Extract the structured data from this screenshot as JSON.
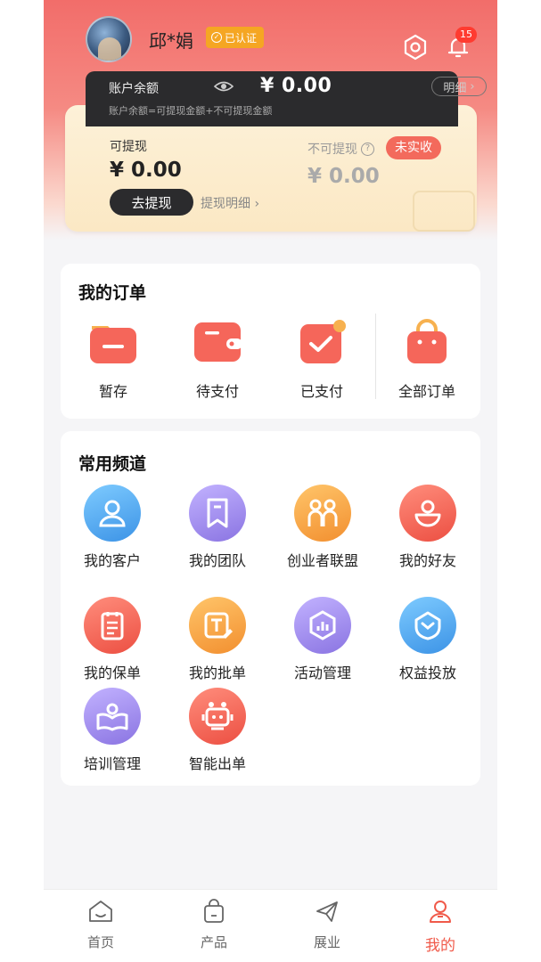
{
  "header": {
    "username": "邱*娟",
    "verified_label": "已认证",
    "notification_count": "15"
  },
  "balance": {
    "label": "账户余额",
    "value": "¥ 0.00",
    "detail_label": "明细",
    "note": "账户余额=可提现金额+不可提现金额"
  },
  "withdraw": {
    "available_label": "可提现",
    "available_value": "¥ 0.00",
    "withdraw_button": "去提现",
    "withdraw_detail_link": "提现明细 ›",
    "unavailable_label": "不可提现",
    "unavailable_help": "?",
    "unavailable_tag": "未实收",
    "unavailable_value": "¥ 0.00"
  },
  "orders": {
    "title": "我的订单",
    "items": [
      {
        "label": "暂存",
        "icon": "folder-icon"
      },
      {
        "label": "待支付",
        "icon": "wallet-icon"
      },
      {
        "label": "已支付",
        "icon": "paid-check-icon"
      },
      {
        "label": "全部订单",
        "icon": "shopping-bag-icon"
      }
    ]
  },
  "channels": {
    "title": "常用频道",
    "items": [
      {
        "label": "我的客户",
        "icon": "customer-icon",
        "color": "#4aa8ee"
      },
      {
        "label": "我的团队",
        "icon": "team-bookmark-icon",
        "color": "#9a86e6"
      },
      {
        "label": "创业者联盟",
        "icon": "alliance-icon",
        "color": "#f5a24a"
      },
      {
        "label": "我的好友",
        "icon": "friend-icon",
        "color": "#f46a5b"
      },
      {
        "label": "我的保单",
        "icon": "policy-icon",
        "color": "#f46a5b"
      },
      {
        "label": "我的批单",
        "icon": "endorsement-icon",
        "color": "#f5a24a"
      },
      {
        "label": "活动管理",
        "icon": "activity-icon",
        "color": "#9a86e6"
      },
      {
        "label": "权益投放",
        "icon": "benefit-icon",
        "color": "#4aa8ee"
      },
      {
        "label": "培训管理",
        "icon": "training-icon",
        "color": "#9a86e6"
      },
      {
        "label": "智能出单",
        "icon": "robot-icon",
        "color": "#f46a5b"
      }
    ]
  },
  "tabbar": {
    "items": [
      {
        "label": "首页",
        "icon": "home-icon"
      },
      {
        "label": "产品",
        "icon": "product-bag-icon"
      },
      {
        "label": "展业",
        "icon": "send-icon"
      },
      {
        "label": "我的",
        "icon": "profile-icon",
        "active": true
      }
    ]
  }
}
